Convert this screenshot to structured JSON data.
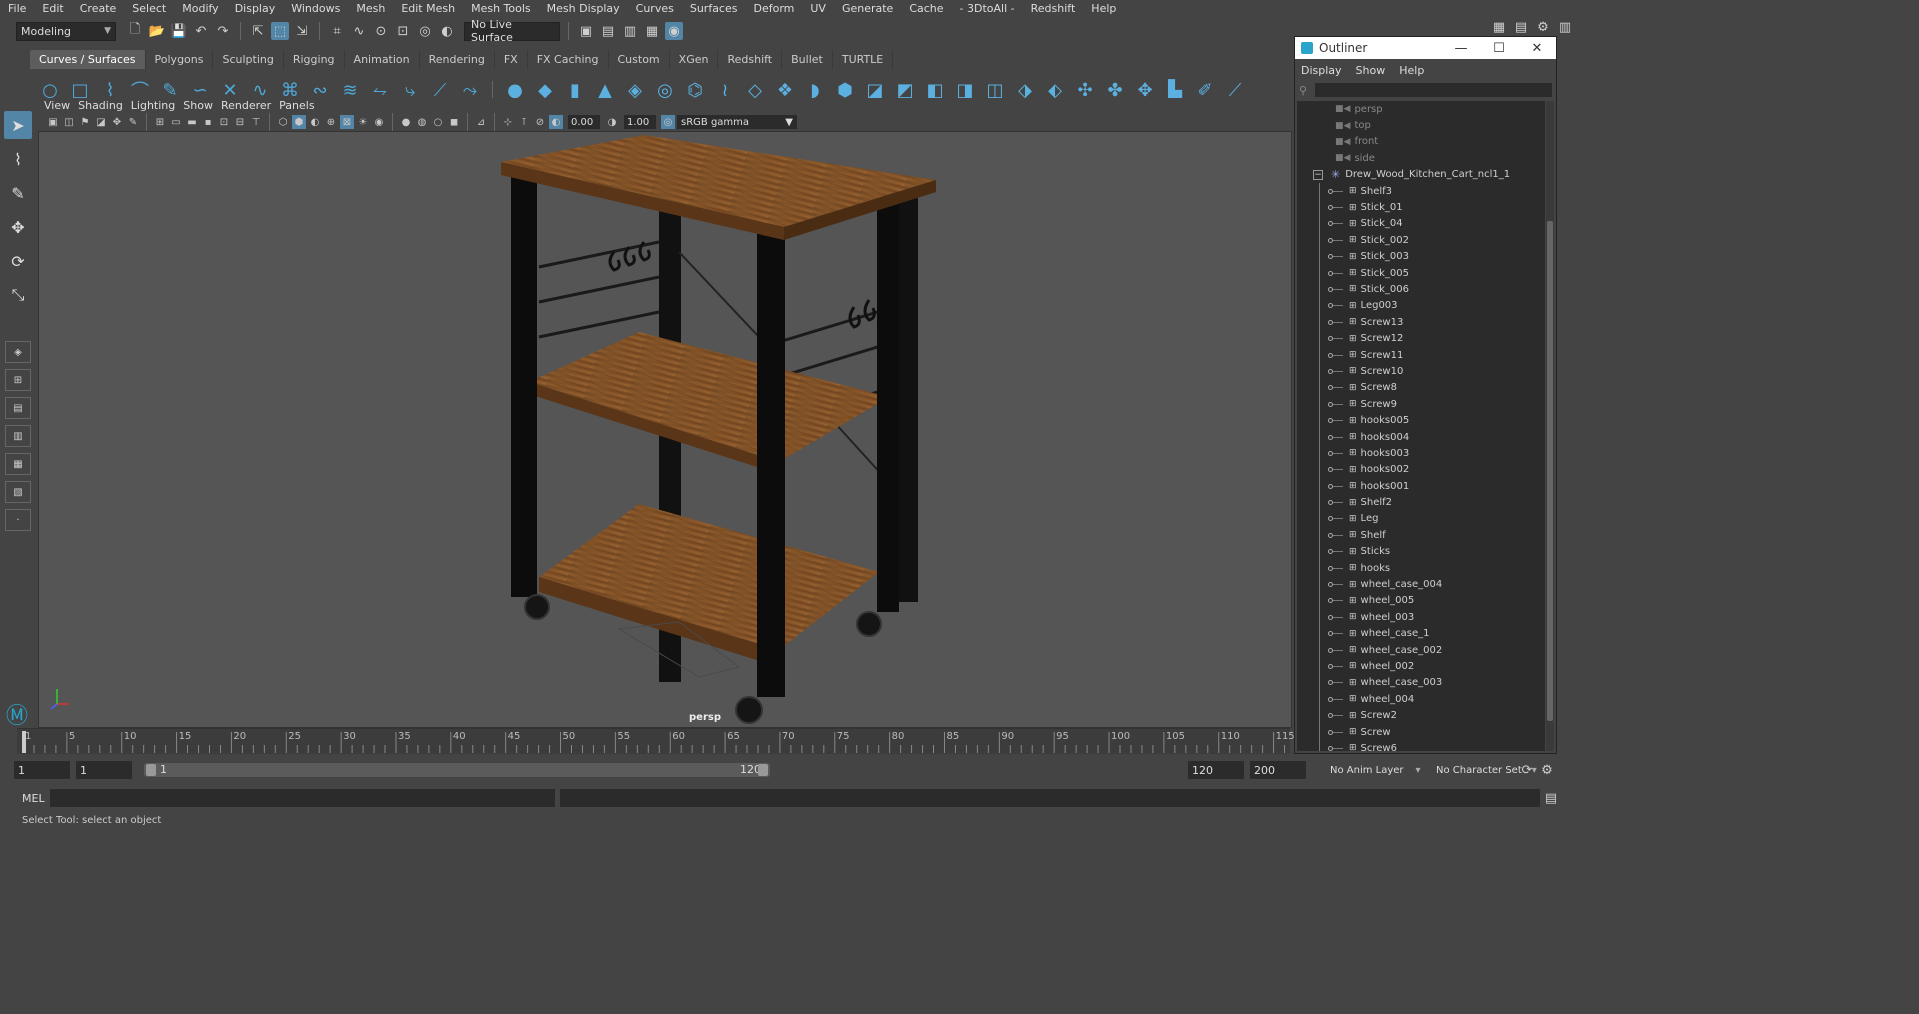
{
  "menubar": {
    "items": [
      "File",
      "Edit",
      "Create",
      "Select",
      "Modify",
      "Display",
      "Windows",
      "Mesh",
      "Edit Mesh",
      "Mesh Tools",
      "Mesh Display",
      "Curves",
      "Surfaces",
      "Deform",
      "UV",
      "Generate",
      "Cache",
      "- 3DtoAll -",
      "Redshift",
      "Help"
    ]
  },
  "statusline": {
    "mode": "Modeling",
    "live_surface": "No Live Surface"
  },
  "shelf": {
    "tabs": [
      "Curves / Surfaces",
      "Polygons",
      "Sculpting",
      "Rigging",
      "Animation",
      "Rendering",
      "FX",
      "FX Caching",
      "Custom",
      "XGen",
      "Redshift",
      "Bullet",
      "TURTLE"
    ],
    "active_tab": "Curves / Surfaces"
  },
  "viewport": {
    "menu": [
      "View",
      "Shading",
      "Lighting",
      "Show",
      "Renderer",
      "Panels"
    ],
    "exposure": "0.00",
    "gamma": "1.00",
    "color_space": "sRGB gamma",
    "camera_label": "persp"
  },
  "timeline": {
    "ticks": [
      "1",
      "5",
      "10",
      "15",
      "20",
      "25",
      "30",
      "35",
      "40",
      "45",
      "50",
      "55",
      "60",
      "65",
      "70",
      "75",
      "80",
      "85",
      "90",
      "95",
      "100",
      "105",
      "110",
      "115"
    ],
    "current_frame": "1"
  },
  "range": {
    "start": "1",
    "playback_start": "1",
    "slider_start": "1",
    "slider_end": "120",
    "playback_end": "120",
    "end": "200",
    "anim_layer": "No Anim Layer",
    "character_set": "No Character Set"
  },
  "cmdline": {
    "label": "MEL",
    "help": "Select Tool: select an object"
  },
  "outliner": {
    "title": "Outliner",
    "menu": [
      "Display",
      "Show",
      "Help"
    ],
    "cameras": [
      "persp",
      "top",
      "front",
      "side"
    ],
    "root": "Drew_Wood_Kitchen_Cart_ncl1_1",
    "children": [
      "Shelf3",
      "Stick_01",
      "Stick_04",
      "Stick_002",
      "Stick_003",
      "Stick_005",
      "Stick_006",
      "Leg003",
      "Screw13",
      "Screw12",
      "Screw11",
      "Screw10",
      "Screw8",
      "Screw9",
      "hooks005",
      "hooks004",
      "hooks003",
      "hooks002",
      "hooks001",
      "Shelf2",
      "Leg",
      "Shelf",
      "Sticks",
      "hooks",
      "wheel_case_004",
      "wheel_005",
      "wheel_003",
      "wheel_case_1",
      "wheel_case_002",
      "wheel_002",
      "wheel_case_003",
      "wheel_004",
      "Screw2",
      "Screw",
      "Screw6"
    ]
  },
  "colors": {
    "accent": "#5285a6",
    "shelf_icon": "#4ea8d8",
    "viewport_bg": "#555555",
    "wood": "#8b5a2b"
  }
}
